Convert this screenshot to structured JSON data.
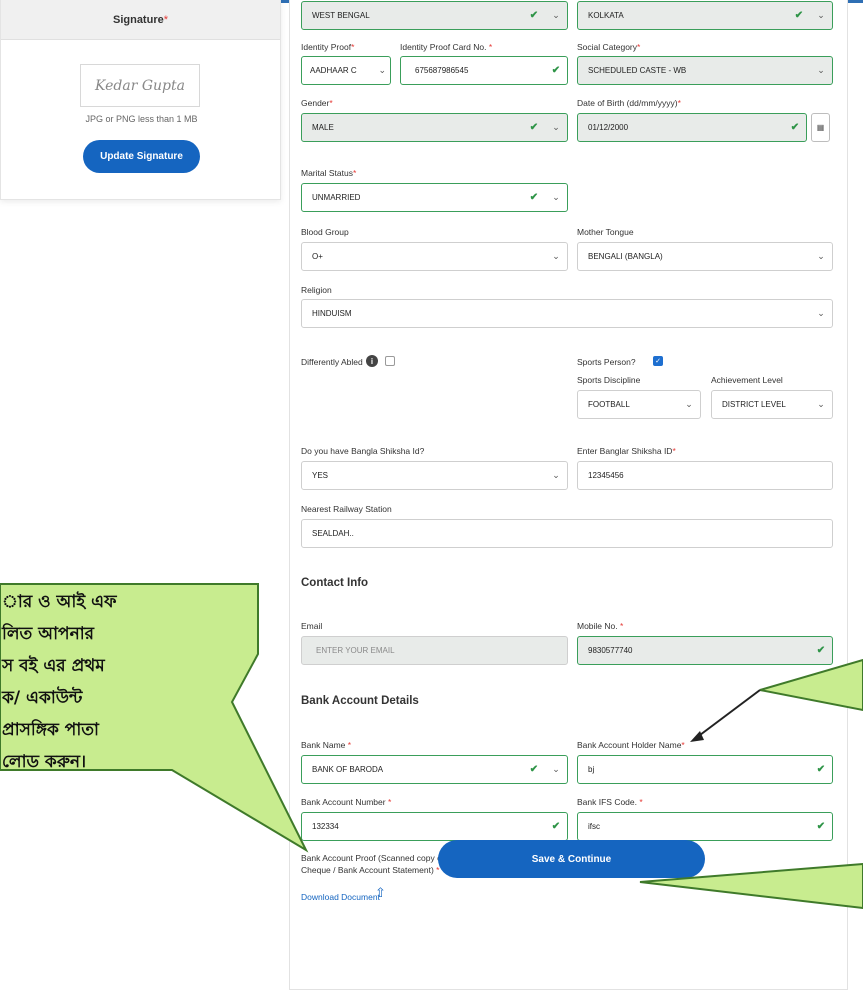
{
  "signature": {
    "header": "Signature",
    "signature_text": "Kedar Gupta",
    "note": "JPG or PNG less than 1 MB",
    "update_button": "Update Signature"
  },
  "form": {
    "state_value": "WEST BENGAL",
    "district_value": "KOLKATA",
    "identity_proof_label": "Identity Proof",
    "identity_proof_value": "AADHAAR C",
    "identity_card_label": "Identity Proof Card No.",
    "identity_card_value": "675687986545",
    "social_category_label": "Social Category",
    "social_category_value": "SCHEDULED CASTE - WB",
    "gender_label": "Gender",
    "gender_value": "MALE",
    "dob_label": "Date of Birth (dd/mm/yyyy)",
    "dob_value": "01/12/2000",
    "marital_label": "Marital Status",
    "marital_value": "UNMARRIED",
    "blood_label": "Blood Group",
    "blood_value": "O+",
    "mother_tongue_label": "Mother Tongue",
    "mother_tongue_value": "BENGALI (BANGLA)",
    "religion_label": "Religion",
    "religion_value": "HINDUISM",
    "differently_abled_label": "Differently Abled",
    "differently_abled_checked": false,
    "sports_person_label": "Sports Person?",
    "sports_person_checked": true,
    "sports_discipline_label": "Sports Discipline",
    "sports_discipline_value": "FOOTBALL",
    "achievement_label": "Achievement Level",
    "achievement_value": "DISTRICT LEVEL",
    "bangla_shiksha_q_label": "Do you have Bangla Shiksha Id?",
    "bangla_shiksha_q_value": "YES",
    "bangla_shiksha_id_label": "Enter Banglar Shiksha ID",
    "bangla_shiksha_id_value": "12345456",
    "railway_label": "Nearest Railway Station",
    "railway_value": "SEALDAH.."
  },
  "contact": {
    "title": "Contact Info",
    "email_label": "Email",
    "email_placeholder": "ENTER YOUR EMAIL",
    "mobile_label": "Mobile No.",
    "mobile_value": "9830577740"
  },
  "bank": {
    "title": "Bank Account Details",
    "bank_name_label": "Bank Name",
    "bank_name_value": "BANK OF BARODA",
    "holder_label": "Bank Account Holder Name",
    "holder_value": "bj",
    "account_no_label": "Bank Account Number",
    "account_no_value": "132334",
    "ifsc_label": "Bank IFS Code.",
    "ifsc_value": "ifsc",
    "proof_label": "Bank Account Proof (Scanned copy of First Page of Passbook / Cheque / Bank Account Statement)",
    "download_link": "Download Document",
    "save_button": "Save & Continue"
  },
  "callout": {
    "lines": [
      "ার ও আই এফ",
      "লিত আপনার",
      "স বই এর প্রথম",
      "ক/ একাউন্ট",
      "প্রাসঙ্গিক পাতা",
      "লোড করুন।"
    ],
    "color": "#c8ec8f",
    "outline": "#3f7a2a"
  },
  "colors": {
    "primary": "#1565c0",
    "success": "#2e9447",
    "required": "#e53935"
  }
}
